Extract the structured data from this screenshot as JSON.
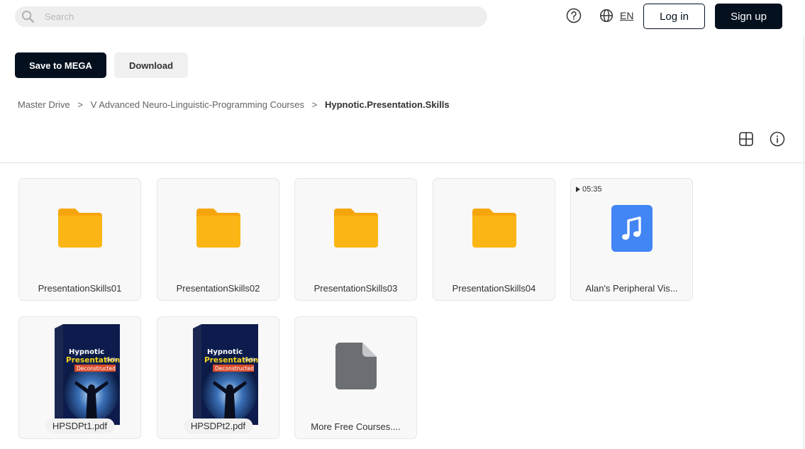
{
  "header": {
    "search_placeholder": "Search",
    "language": "EN",
    "login_label": "Log in",
    "signup_label": "Sign up"
  },
  "actions": {
    "save_label": "Save to MEGA",
    "download_label": "Download"
  },
  "breadcrumb": {
    "items": [
      "Master Drive",
      "V Advanced Neuro-Linguistic-Programming Courses",
      "Hypnotic.Presentation.Skills"
    ],
    "separator": ">"
  },
  "files": [
    {
      "name": "PresentationSkills01",
      "type": "folder"
    },
    {
      "name": "PresentationSkills02",
      "type": "folder"
    },
    {
      "name": "PresentationSkills03",
      "type": "folder"
    },
    {
      "name": "PresentationSkills04",
      "type": "folder"
    },
    {
      "name": "Alan's Peripheral Vis...",
      "type": "audio",
      "duration": "05:35"
    },
    {
      "name": "HPSDPt1.pdf",
      "type": "pdf",
      "cover_text": [
        "Hypnotic",
        "Presentation",
        "Skills",
        "Deconstructed"
      ]
    },
    {
      "name": "HPSDPt2.pdf",
      "type": "pdf",
      "cover_text": [
        "Hypnotic",
        "Presentation",
        "Skills",
        "Deconstructed"
      ]
    },
    {
      "name": "More Free Courses....",
      "type": "file"
    }
  ],
  "colors": {
    "primary_dark": "#04101e",
    "folder": "#fbb615",
    "audio": "#4285f4",
    "generic_file": "#6b6e72"
  }
}
